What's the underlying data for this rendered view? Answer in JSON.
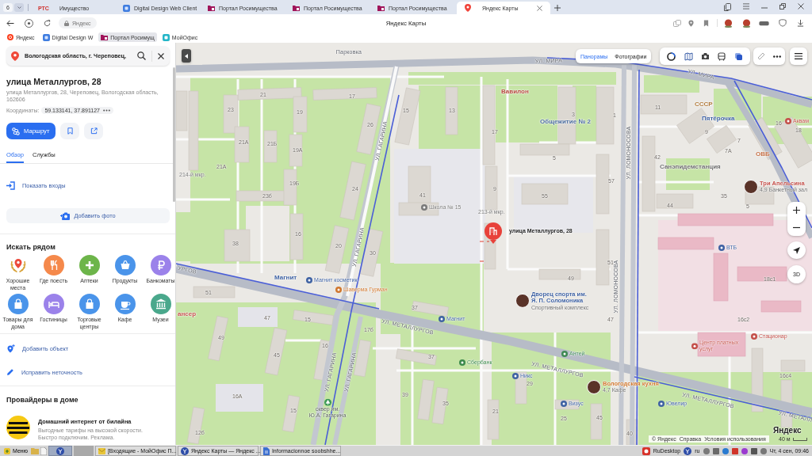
{
  "browser": {
    "tab_count": "6",
    "tabs": [
      {
        "kind": "rts",
        "badge": "РТС",
        "label": "Имущество",
        "selected": false
      },
      {
        "kind": "dd",
        "label": "Digital Design Web Client",
        "selected": false
      },
      {
        "kind": "portal",
        "label": "Портал Росимущества",
        "selected": false
      },
      {
        "kind": "portal",
        "label": "Портал Росимущества",
        "selected": false
      },
      {
        "kind": "portal",
        "label": "Портал Росимущества",
        "selected": false
      },
      {
        "kind": "maps",
        "label": "Яндекс Карты",
        "selected": true
      }
    ],
    "address": "Яндекс",
    "page_title": "Яндекс Карты",
    "bookmarks": [
      {
        "kind": "yandex",
        "label": "Яндекс",
        "hovered": false
      },
      {
        "kind": "dd",
        "label": "Digital Design W",
        "hovered": false
      },
      {
        "kind": "portal",
        "label": "Портал Росимущ",
        "hovered": true
      },
      {
        "kind": "office",
        "label": "МойОфис",
        "hovered": false
      }
    ]
  },
  "panel": {
    "search": {
      "value": "Вологодская область, г. Череповец,"
    },
    "title": "улица Металлургов, 28",
    "address": "улица Металлургов, 28, Череповец, Вологодская область, 162606",
    "coordinates_label": "Координаты:",
    "coordinates": "59.133141, 37.891127",
    "route_button": "Маршрут",
    "tabs": [
      {
        "label": "Обзор",
        "selected": true
      },
      {
        "label": "Службы",
        "selected": false
      }
    ],
    "show_entrances": "Показать входы",
    "add_photo": "Добавить фото",
    "nearby": {
      "title": "Искать рядом",
      "categories": [
        {
          "label": "Хорошие места",
          "kind": "laurel",
          "color": "#ec4a3c"
        },
        {
          "label": "Где поесть",
          "kind": "food",
          "color": "#f5894b"
        },
        {
          "label": "Аптеки",
          "kind": "pharmacy",
          "color": "#6db54a"
        },
        {
          "label": "Продукты",
          "kind": "groceries",
          "color": "#4a94ea"
        },
        {
          "label": "Банкоматы",
          "kind": "atm",
          "color": "#9b82ea"
        },
        {
          "label": "Товары для дома",
          "kind": "bag",
          "color": "#4a94ea"
        },
        {
          "label": "Гостиницы",
          "kind": "hotel",
          "color": "#9b82ea"
        },
        {
          "label": "Торговые центры",
          "kind": "bag",
          "color": "#4a94ea"
        },
        {
          "label": "Кафе",
          "kind": "cup",
          "color": "#4a94ea"
        },
        {
          "label": "Музеи",
          "kind": "museum",
          "color": "#4aa88c"
        }
      ]
    },
    "actions": [
      {
        "kind": "add",
        "label": "Добавить объект"
      },
      {
        "kind": "edit",
        "label": "Исправить неточность"
      }
    ],
    "providers": {
      "title": "Провайдеры в доме",
      "items": [
        {
          "name": "Домашний интернет от билайна",
          "description": "Выгодные тарифы на высокой скорости. Быстро подключим. Реклама."
        }
      ]
    }
  },
  "map": {
    "layer_tabs": [
      {
        "label": "Панорамы",
        "selected": true
      },
      {
        "label": "Фотографии",
        "selected": false
      }
    ],
    "view_3d": "3D",
    "marker_label": "улица Металлургов, 28",
    "streets": [
      "Парковка",
      "УЛ. МИРА",
      "УЛ. МИРА",
      "УЛ. ГАГАРИНА",
      "УЛ. ЛОМОНОСОВА",
      "УРГОВ",
      "УЛ. ГАГАРИНА",
      "УЛ. ЛОМОНОСОВА",
      "УЛ. МЕТАЛЛУРГОВ",
      "УЛ. ГАГАРИНА",
      "УЛ. ГАГАРИНА",
      "УЛ. МЕТАЛЛУРГОВ",
      "УЛ. МЕТАЛЛУРГОВ",
      "УЛ. МЕТАЛЛ"
    ],
    "places": [
      {
        "text": "Вавилон",
        "kind": "place",
        "color": "#b5483c"
      },
      {
        "text": "СССР",
        "kind": "place",
        "color": "#b07a3c"
      },
      {
        "text": "Общежитие № 2",
        "kind": "place",
        "color": "#4a6b9c"
      },
      {
        "text": "Пятёрочка",
        "kind": "place",
        "color": "#3f62a3"
      },
      {
        "text": "Аквам",
        "kind": "pin",
        "color": "#c4504a"
      },
      {
        "text": "ОВБ",
        "kind": "place",
        "color": "#c46f45"
      },
      {
        "text": "Санэпидемстанция",
        "kind": "place",
        "color": "#6e6e6e"
      },
      {
        "text": "214-й мкр.",
        "kind": "district"
      },
      {
        "text": "Три Апельсина",
        "kind": "photo",
        "color": "#c4504a",
        "note": "4,9 Банкетный зал"
      },
      {
        "text": "Школа № 15",
        "kind": "pin",
        "color": "#7a7a7a"
      },
      {
        "text": "213-й мкр.",
        "kind": "district"
      },
      {
        "text": "ВТБ",
        "kind": "pin",
        "color": "#3f62a3"
      },
      {
        "text": "Магнит",
        "kind": "place",
        "color": "#3f62a3"
      },
      {
        "text": "Магнит косметик",
        "kind": "pin",
        "color": "#3f62a3"
      },
      {
        "text": "Шаверма Гурман",
        "kind": "pin",
        "color": "#d0772e"
      },
      {
        "text": "Дворец спорта им. Я. П. Соломоника",
        "kind": "photo",
        "color": "#3f62a3",
        "note": "Спортивный комплекс"
      },
      {
        "text": "ансер",
        "kind": "place",
        "color": "#c4504a"
      },
      {
        "text": "Магнит",
        "kind": "pin",
        "color": "#3f62a3"
      },
      {
        "text": "Стационар",
        "kind": "pin",
        "color": "#c4504a"
      },
      {
        "text": "Антей",
        "kind": "pin",
        "color": "#3f8a55"
      },
      {
        "text": "Центр платных услуг",
        "kind": "pin",
        "color": "#c4504a"
      },
      {
        "text": "Сбербанк",
        "kind": "pin",
        "color": "#3c8a4c"
      },
      {
        "text": "Никс",
        "kind": "pin",
        "color": "#3f62a3"
      },
      {
        "text": "Вологодская кухня",
        "kind": "photo",
        "color": "#d0772e",
        "note": "4,7 Кафе"
      },
      {
        "text": "сквер им. Ю.А. Гагарина",
        "kind": "park"
      },
      {
        "text": "Визус",
        "kind": "pin",
        "color": "#3f62a3"
      },
      {
        "text": "Ювелир",
        "kind": "pin",
        "color": "#3f62a3"
      }
    ],
    "house_numbers": [
      "21",
      "17",
      "23",
      "19",
      "15",
      "13",
      "11",
      "3",
      "1",
      "26",
      "16",
      "17",
      "9",
      "18",
      "21А",
      "21Б",
      "7",
      "19А",
      "7А",
      "5",
      "42",
      "21А",
      "19Б",
      "57",
      "24",
      "9",
      "23б",
      "41",
      "55",
      "35",
      "44",
      "5",
      "16",
      "38",
      "20",
      "30",
      "51",
      "49",
      "18с1",
      "51",
      "37",
      "47",
      "15",
      "47",
      "16с2",
      "17б",
      "49",
      "16",
      "45",
      "37",
      "16с4",
      "29",
      "16А",
      "39",
      "35",
      "15",
      "21",
      "25",
      "45",
      "12б",
      "40"
    ],
    "logo": "Яндекс",
    "attribution": [
      "© Яндекс",
      "Справка",
      "Условия использования"
    ],
    "scale": "40 м"
  },
  "taskbar": {
    "start": "Меню",
    "buttons": [
      {
        "kind": "browser",
        "pressed": true
      },
      {
        "kind": "empty",
        "pressed": false
      }
    ],
    "windows": [
      {
        "kind": "mail",
        "label": "[Входящие - МойОфис П..."
      },
      {
        "kind": "browser",
        "label": "Яндекс Карты — Яндекс ..."
      },
      {
        "kind": "document",
        "label": "Informacionnoe soobshhe..."
      }
    ],
    "tray_app": "RuDesktop",
    "language": "ru",
    "clock": "Чт, 4 сен, 09:46"
  }
}
